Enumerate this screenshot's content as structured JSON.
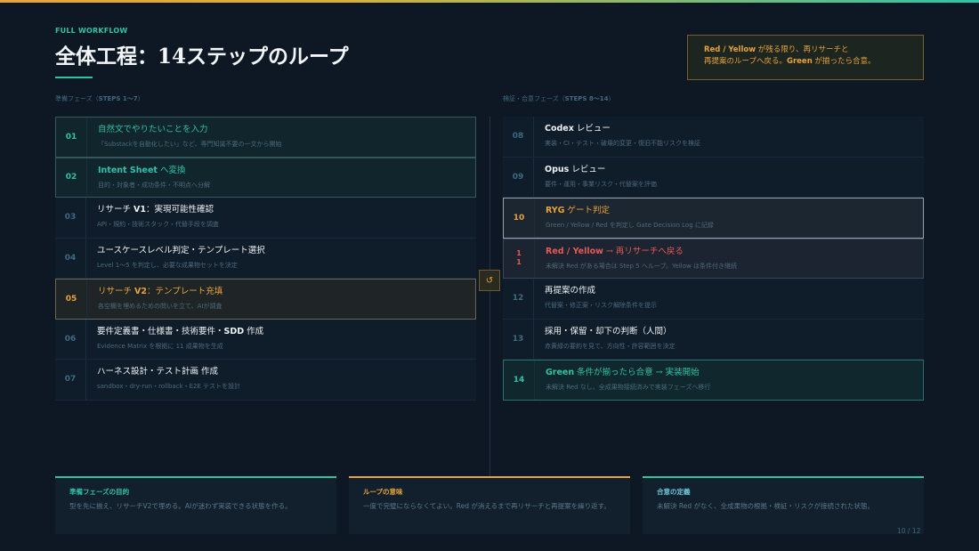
{
  "header": {
    "eyebrow": "FULL WORKFLOW",
    "title": "全体工程：14ステップのループ"
  },
  "callout": {
    "line1_b": "Red / Yellow",
    "line1_rest": " が残る限り、再リサーチと",
    "line2_a": "再提案のループへ戻る。",
    "line2_b": "Green",
    "line2_rest": " が揃ったら合意。"
  },
  "phases": {
    "left_label": "準備フェーズ（",
    "left_steps": "STEPS 1〜7",
    "left_close": "）",
    "right_label": "検証・合意フェーズ（",
    "right_steps": "STEPS 8〜14",
    "right_close": "）"
  },
  "steps_left": [
    {
      "num": "01",
      "title": "自然文でやりたいことを入力",
      "desc": "「Substackを自動化したい」など、専門知識不要の一文から開始"
    },
    {
      "num": "02",
      "title_b": "Intent Sheet",
      "title_rest": " へ変換",
      "desc": "目的・対象者・成功条件・不明点へ分解"
    },
    {
      "num": "03",
      "title_a": "リサーチ ",
      "title_b": "V1",
      "title_rest": "：実現可能性確認",
      "desc": "API・規約・技術スタック・代替手段を調査"
    },
    {
      "num": "04",
      "title": "ユースケースレベル判定・テンプレート選択",
      "desc": "Level 1〜5 を判定し、必要な成果物セットを決定"
    },
    {
      "num": "05",
      "title_a": "リサーチ ",
      "title_b": "V2",
      "title_rest": "：テンプレート充填",
      "desc": "各空欄を埋めるための問いを立て、AIが調査"
    },
    {
      "num": "06",
      "title_a": "要件定義書・仕様書・技術要件・",
      "title_b": "SDD",
      "title_rest": " 作成",
      "desc": "Evidence Matrix を根拠に 11 成果物を生成"
    },
    {
      "num": "07",
      "title": "ハーネス設計・テスト計画 作成",
      "desc": "sandbox・dry-run・rollback・E2E テストを設計"
    }
  ],
  "steps_right": [
    {
      "num": "08",
      "title_b": "Codex",
      "title_rest": " レビュー",
      "desc": "実装・CI・テスト・破壊的変更・復旧不能リスクを検証"
    },
    {
      "num": "09",
      "title_b": "Opus",
      "title_rest": " レビュー",
      "desc": "要件・運用・事業リスク・代替案を評価"
    },
    {
      "num": "10",
      "title_b": "RYG",
      "title_rest": " ゲート判定",
      "desc": "Green / Yellow / Red を判定し Gate Decision Log に記録"
    },
    {
      "num_a": "1",
      "num_b": "1",
      "title_b": "Red / Yellow",
      "title_rest": " → 再リサーチへ戻る",
      "desc": "未解決 Red がある場合は Step 5 へループ。Yellow は条件付き継続"
    },
    {
      "num": "12",
      "title": "再提案の作成",
      "desc": "代替案・修正案・リスク解除条件を提示"
    },
    {
      "num": "13",
      "title": "採用・保留・却下の判断（人間）",
      "desc": "赤黄緑の要約を見て、方向性・許容範囲を決定"
    },
    {
      "num": "14",
      "title_b": "Green",
      "title_rest": " 条件が揃ったら合意 → 実装開始",
      "desc": "未解決 Red なし、全成果物接続済みで実装フェーズへ移行"
    }
  ],
  "loop_icon": "↺",
  "cards": [
    {
      "title": "準備フェーズの目的",
      "desc": "型を先に揃え、リサーチV2で埋める。AIが迷わず実装できる状態を作る。"
    },
    {
      "title": "ループの意味",
      "desc": "一度で完璧にならなくてよい。Red が消えるまで再リサーチと再提案を繰り返す。"
    },
    {
      "title": "合意の定義",
      "desc": "未解決 Red がなく、全成果物の根拠・検証・リスクが接続された状態。"
    }
  ],
  "page": "10 / 12",
  "colors": {
    "teal": "#2fc3a6",
    "gold": "#e8a33a",
    "red": "#e65a55",
    "background": "#0d1824"
  }
}
